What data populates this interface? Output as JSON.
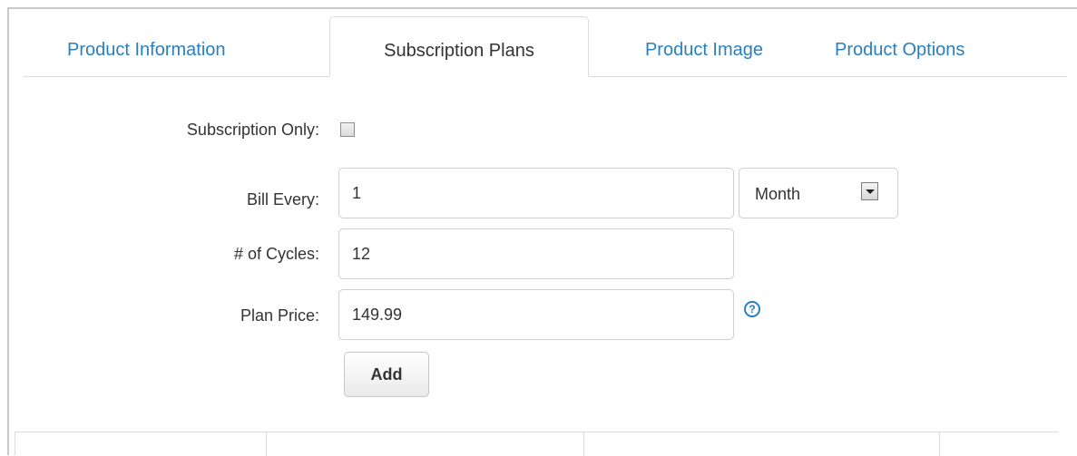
{
  "tabs": [
    {
      "label": "Product Information",
      "active": false
    },
    {
      "label": "Subscription Plans",
      "active": true
    },
    {
      "label": "Product Image",
      "active": false
    },
    {
      "label": "Product Options",
      "active": false
    }
  ],
  "form": {
    "subscription_only": {
      "label": "Subscription Only:",
      "checked": false
    },
    "bill_every": {
      "label": "Bill Every:",
      "value": "1",
      "period": "Month"
    },
    "cycles": {
      "label": "# of Cycles:",
      "value": "12"
    },
    "plan_price": {
      "label": "Plan Price:",
      "value": "149.99",
      "help_icon": "question-circle-icon"
    },
    "add_button": "Add"
  },
  "colors": {
    "link": "#2a7fbf",
    "text": "#333333",
    "border": "#cfcfcf"
  }
}
